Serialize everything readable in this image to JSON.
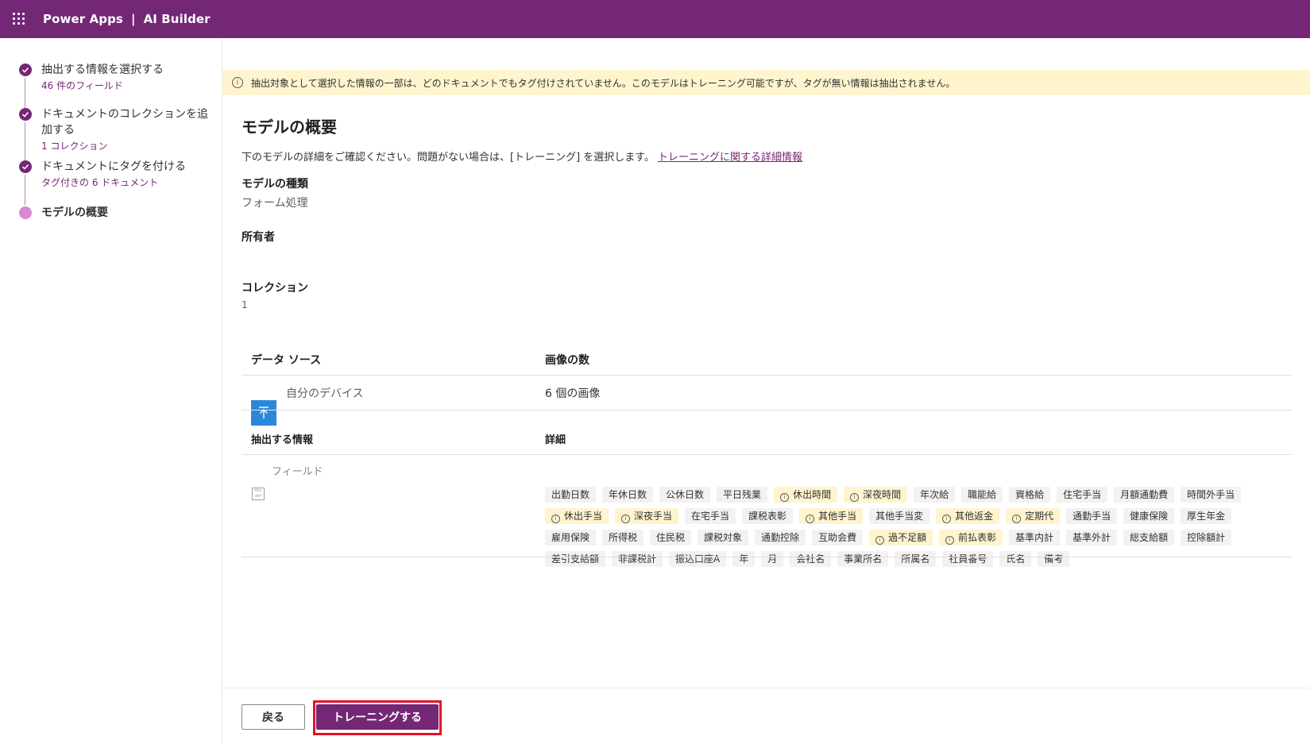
{
  "header": {
    "app_name": "Power Apps",
    "separator": "|",
    "section": "AI Builder"
  },
  "steps": [
    {
      "label": "抽出する情報を選択する",
      "sub": "46 件のフィールド",
      "state": "done"
    },
    {
      "label": "ドキュメントのコレクションを追加する",
      "sub": "1 コレクション",
      "state": "done"
    },
    {
      "label": "ドキュメントにタグを付ける",
      "sub": "タグ付きの 6 ドキュメント",
      "state": "done"
    },
    {
      "label": "モデルの概要",
      "sub": "",
      "state": "current"
    }
  ],
  "banner": {
    "icon": "info-icon",
    "text": "抽出対象として選択した情報の一部は、どのドキュメントでもタグ付けされていません。このモデルはトレーニング可能ですが、タグが無い情報は抽出されません。"
  },
  "summary": {
    "title": "モデルの概要",
    "description": "下のモデルの詳細をご確認ください。問題がない場合は、[トレーニング] を選択します。",
    "link": "トレーニングに関する詳細情報",
    "model_type_label": "モデルの種類",
    "model_type_value": "フォーム処理",
    "owner_label": "所有者",
    "owner_value": "",
    "collection_label": "コレクション",
    "collection_value": "1"
  },
  "datasource_table": {
    "col1": "データ ソース",
    "col2": "画像の数",
    "row_source": "自分のデバイス",
    "row_count": "6 個の画像"
  },
  "extract_table": {
    "col1": "抽出する情報",
    "col2": "詳細",
    "row_type": "フィールド",
    "field_icon_text": "Abc def",
    "tags": [
      {
        "t": "出勤日数",
        "w": false
      },
      {
        "t": "年休日数",
        "w": false
      },
      {
        "t": "公休日数",
        "w": false
      },
      {
        "t": "平日残業",
        "w": false
      },
      {
        "t": "休出時間",
        "w": true
      },
      {
        "t": "深夜時間",
        "w": true
      },
      {
        "t": "年次給",
        "w": false
      },
      {
        "t": "職能給",
        "w": false
      },
      {
        "t": "資格給",
        "w": false
      },
      {
        "t": "住宅手当",
        "w": false
      },
      {
        "t": "月額通勤費",
        "w": false
      },
      {
        "t": "時間外手当",
        "w": false
      },
      {
        "t": "休出手当",
        "w": true
      },
      {
        "t": "深夜手当",
        "w": true
      },
      {
        "t": "在宅手当",
        "w": false
      },
      {
        "t": "課税表彰",
        "w": false
      },
      {
        "t": "其他手当",
        "w": true
      },
      {
        "t": "其他手当変",
        "w": false
      },
      {
        "t": "其他返金",
        "w": true
      },
      {
        "t": "定期代",
        "w": true
      },
      {
        "t": "通勤手当",
        "w": false
      },
      {
        "t": "健康保険",
        "w": false
      },
      {
        "t": "厚生年金",
        "w": false
      },
      {
        "t": "雇用保険",
        "w": false
      },
      {
        "t": "所得税",
        "w": false
      },
      {
        "t": "住民税",
        "w": false
      },
      {
        "t": "課税対象",
        "w": false
      },
      {
        "t": "通勤控除",
        "w": false
      },
      {
        "t": "互助会費",
        "w": false
      },
      {
        "t": "過不足額",
        "w": true
      },
      {
        "t": "前払表彰",
        "w": true
      },
      {
        "t": "基準内計",
        "w": false
      },
      {
        "t": "基準外計",
        "w": false
      },
      {
        "t": "総支給額",
        "w": false
      },
      {
        "t": "控除額計",
        "w": false
      },
      {
        "t": "差引支給額",
        "w": false
      },
      {
        "t": "非課税計",
        "w": false
      },
      {
        "t": "振込口座A",
        "w": false
      },
      {
        "t": "年",
        "w": false
      },
      {
        "t": "月",
        "w": false
      },
      {
        "t": "会社名",
        "w": false
      },
      {
        "t": "事業所名",
        "w": false
      },
      {
        "t": "所属名",
        "w": false
      },
      {
        "t": "社員番号",
        "w": false
      },
      {
        "t": "氏名",
        "w": false
      },
      {
        "t": "備考",
        "w": false
      }
    ]
  },
  "footer": {
    "back_label": "戻る",
    "train_label": "トレーニングする"
  },
  "colors": {
    "brand": "#742774",
    "warning_bg": "#fff4ce",
    "highlight_border": "#e81123",
    "device_icon_bg": "#2b88d8"
  }
}
